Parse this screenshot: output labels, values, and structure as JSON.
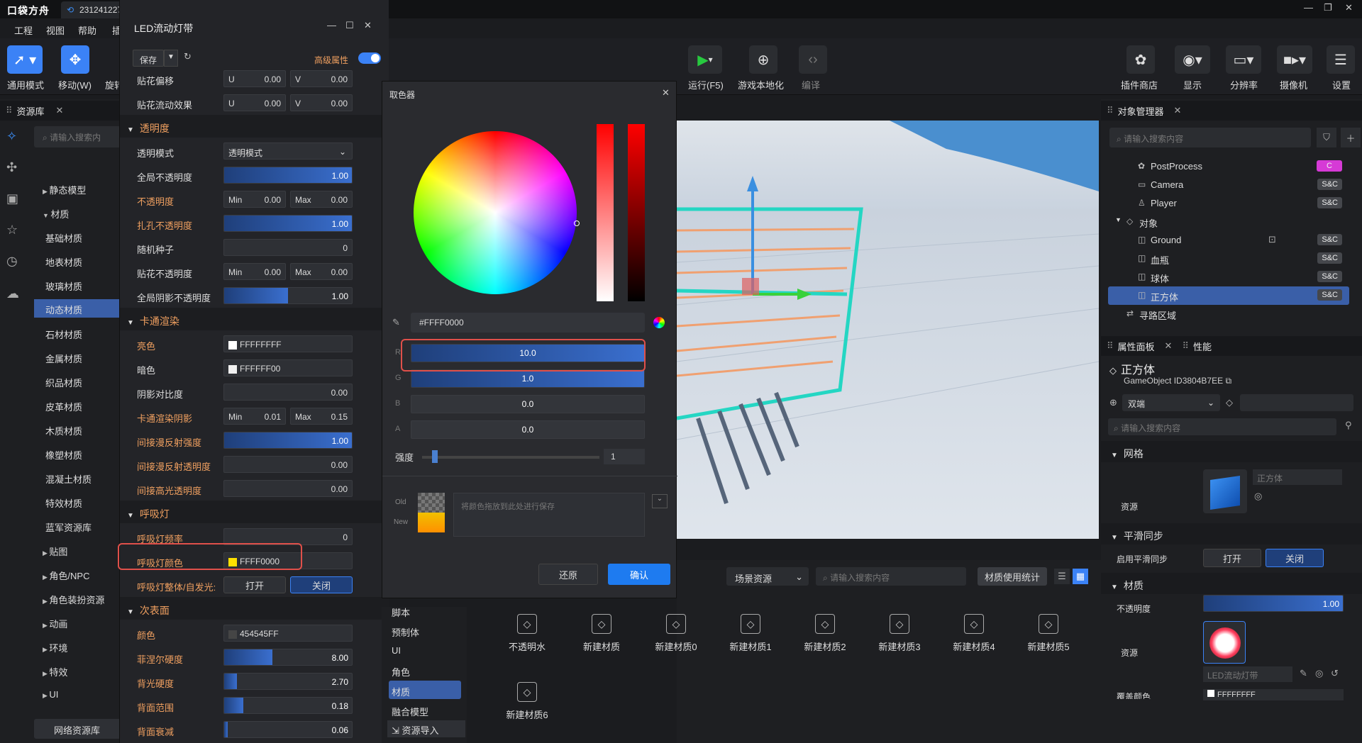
{
  "app": {
    "logo": "口袋方舟",
    "tab": "231241227",
    "menus": [
      "工程",
      "视图",
      "帮助",
      "插"
    ]
  },
  "toolbar": {
    "tools": [
      {
        "label": "通用模式",
        "icon": "cursor-icon"
      },
      {
        "label": "移动(W)",
        "icon": "move-icon"
      },
      {
        "label": "旋转",
        "icon": "rotate-icon"
      }
    ],
    "center": [
      {
        "label": "运行(F5)",
        "icon": "play-icon"
      },
      {
        "label": "游戏本地化",
        "icon": "globe-icon"
      },
      {
        "label": "编译",
        "icon": "code-icon"
      }
    ],
    "right": [
      {
        "label": "插件商店",
        "icon": "puzzle-icon"
      },
      {
        "label": "显示",
        "icon": "eye-icon"
      },
      {
        "label": "分辨率",
        "icon": "monitor-icon"
      },
      {
        "label": "摄像机",
        "icon": "camera-icon"
      },
      {
        "label": "设置",
        "icon": "settings-icon"
      }
    ]
  },
  "asset_panel": {
    "title": "资源库",
    "search_placeholder": "请输入搜索内",
    "tree": [
      "静态模型",
      "材质",
      "基础材质",
      "地表材质",
      "玻璃材质",
      "动态材质",
      "石材材质",
      "金属材质",
      "织品材质",
      "皮革材质",
      "木质材质",
      "橡塑材质",
      "混凝土材质",
      "特效材质",
      "蓝军资源库",
      "贴图",
      "角色/NPC",
      "角色装扮资源",
      "动画",
      "环境",
      "特效",
      "UI"
    ],
    "selected": "动态材质",
    "network_button": "网络资源库"
  },
  "material_window": {
    "title": "LED流动灯带",
    "save": "保存",
    "advanced": "高级属性",
    "rows": {
      "tiehua_offset": {
        "label": "贴花偏移",
        "u": "U",
        "uv": "0.00",
        "v": "V",
        "vv": "0.00"
      },
      "tiehua_flow": {
        "label": "贴花流动效果",
        "u": "U",
        "uv": "0.00",
        "v": "V",
        "vv": "0.00"
      },
      "sect_transparency": "透明度",
      "mode": {
        "label": "透明模式",
        "value": "透明模式"
      },
      "global_opacity": {
        "label": "全局不透明度",
        "value": "1.00",
        "fill": 1.0
      },
      "opacity": {
        "label": "不透明度",
        "min": "Min",
        "minv": "0.00",
        "max": "Max",
        "maxv": "0.00"
      },
      "hole": {
        "label": "扎孔不透明度",
        "value": "1.00",
        "fill": 1.0
      },
      "seed": {
        "label": "随机种子",
        "value": "0"
      },
      "decal_opacity": {
        "label": "贴花不透明度",
        "min": "Min",
        "minv": "0.00",
        "max": "Max",
        "maxv": "0.00"
      },
      "shadow_opacity": {
        "label": "全局阴影不透明度",
        "value": "1.00",
        "fill": 0.5
      },
      "sect_toon": "卡通渲染",
      "bright": {
        "label": "亮色",
        "value": "FFFFFFFF"
      },
      "dark": {
        "label": "暗色",
        "value": "FFFFFF00"
      },
      "shadow_contrast": {
        "label": "阴影对比度",
        "value": "0.00"
      },
      "toon_shadow": {
        "label": "卡通渲染阴影",
        "min": "Min",
        "minv": "0.01",
        "max": "Max",
        "maxv": "0.15"
      },
      "indirect_diffuse": {
        "label": "间接漫反射强度",
        "value": "1.00",
        "fill": 1.0
      },
      "indirect_diffuse_op": {
        "label": "间接漫反射透明度",
        "value": "0.00"
      },
      "indirect_spec": {
        "label": "间接高光透明度",
        "value": "0.00"
      },
      "sect_breath": "呼吸灯",
      "breath_freq": {
        "label": "呼吸灯频率",
        "value": "0"
      },
      "breath_color": {
        "label": "呼吸灯颜色",
        "value": "FFFF0000"
      },
      "breath_emit": {
        "label": "呼吸灯整体/自发光:",
        "on": "打开",
        "off": "关闭"
      },
      "sect_sub": "次表面",
      "sub_color": {
        "label": "颜色",
        "value": "454545FF"
      },
      "fresnel": {
        "label": "菲涅尔硬度",
        "value": "8.00",
        "fill": 0.38
      },
      "back_hard": {
        "label": "背光硬度",
        "value": "2.70",
        "fill": 0.1
      },
      "back_range": {
        "label": "背面范围",
        "value": "0.18",
        "fill": 0.15
      },
      "back_decay": {
        "label": "背面衰减",
        "value": "0.06",
        "fill": 0.03
      }
    }
  },
  "picker": {
    "title": "取色器",
    "hex": "#FFFF0000",
    "channels": [
      {
        "name": "R",
        "value": "10.0",
        "fill": 1.0
      },
      {
        "name": "G",
        "value": "1.0",
        "fill": 1.0
      },
      {
        "name": "B",
        "value": "0.0",
        "fill": 0
      },
      {
        "name": "A",
        "value": "0.0",
        "fill": 0
      }
    ],
    "intensity_label": "强度",
    "intensity": "1",
    "old": "Old",
    "new": "New",
    "save_hint": "将颜色拖放到此处进行保存",
    "reset": "还原",
    "confirm": "确认"
  },
  "object_manager": {
    "title": "对象管理器",
    "search_placeholder": "请输入搜索内容",
    "items": [
      {
        "name": "PostProcess",
        "tag": "C",
        "tagcolor": "#d63ad6"
      },
      {
        "name": "Camera",
        "tag": "S&C"
      },
      {
        "name": "Player",
        "tag": "S&C"
      },
      {
        "name": "对象",
        "tag": ""
      },
      {
        "name": "Ground",
        "tag": "S&C"
      },
      {
        "name": "血瓶",
        "tag": "S&C"
      },
      {
        "name": "球体",
        "tag": "S&C"
      },
      {
        "name": "正方体",
        "tag": "S&C"
      },
      {
        "name": "寻路区域",
        "tag": ""
      }
    ],
    "selected": "正方体"
  },
  "properties": {
    "tab1": "属性面板",
    "tab2": "性能",
    "name": "正方体",
    "gameobject_label": "GameObject ID",
    "gameobject_id": "3804B7EE",
    "net": "双端",
    "search_placeholder": "请输入搜索内容",
    "mesh_sect": "网格",
    "mesh_res_label": "资源",
    "mesh_res": "正方体",
    "smooth_sect": "平滑同步",
    "smooth_label": "启用平滑同步",
    "smooth_on": "打开",
    "smooth_off": "关闭",
    "mat_sect": "材质",
    "opacity_label": "不透明度",
    "opacity": "1.00",
    "mat_res_label": "资源",
    "mat_name": "LED流动灯带",
    "overlay_label": "覆盖颜色",
    "overlay": "FFFFFFFF"
  },
  "bottom": {
    "scene_assets": "场景资源",
    "search_placeholder": "请输入搜索内容",
    "stats": "材质使用统计",
    "cats": [
      "脚本",
      "预制体",
      "UI",
      "角色",
      "材质",
      "融合模型"
    ],
    "selected_cat": "材质",
    "import": "资源导入",
    "assets": [
      "不透明水",
      "新建材质",
      "新建材质0",
      "新建材质1",
      "新建材质2",
      "新建材质3",
      "新建材质4",
      "新建材质5",
      "新建材质6"
    ]
  },
  "colors": {
    "accent": "#3b82f6",
    "highlight": "#e0504a",
    "orange_label": "#f0a060"
  }
}
